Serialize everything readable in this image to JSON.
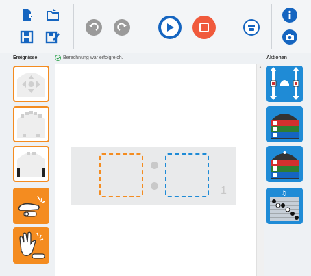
{
  "toolbar": {
    "buttons": [
      {
        "name": "new-file-icon"
      },
      {
        "name": "open-folder-icon"
      },
      {
        "name": "save-icon"
      },
      {
        "name": "save-as-icon"
      },
      {
        "name": "undo-icon"
      },
      {
        "name": "redo-icon"
      },
      {
        "name": "run-icon"
      },
      {
        "name": "stop-icon"
      },
      {
        "name": "robot-icon"
      },
      {
        "name": "info-icon"
      },
      {
        "name": "camera-icon"
      }
    ],
    "colors": {
      "primary": "#1565c0",
      "stop": "#f05a3c",
      "disabled": "#9a9a9a"
    }
  },
  "left_panel": {
    "title": "Ereignisse"
  },
  "right_panel": {
    "title": "Aktionen"
  },
  "status": {
    "text": "Berechnung war erfolgreich.",
    "color": "#27a048"
  },
  "events": [
    {
      "name": "event-buttons"
    },
    {
      "name": "event-ground-sensors"
    },
    {
      "name": "event-prox-sensors"
    },
    {
      "name": "event-tap"
    },
    {
      "name": "event-clap"
    }
  ],
  "actions": [
    {
      "name": "action-motors"
    },
    {
      "name": "action-top-color"
    },
    {
      "name": "action-bottom-color"
    },
    {
      "name": "action-music"
    }
  ],
  "canvas": {
    "state_index": "1",
    "colors": {
      "event_slot": "#f48c20",
      "action_slot": "#1f8bd6",
      "card": "#e9eaeb"
    }
  },
  "colors": {
    "event": "#f48c20",
    "action": "#1f8bd6"
  }
}
